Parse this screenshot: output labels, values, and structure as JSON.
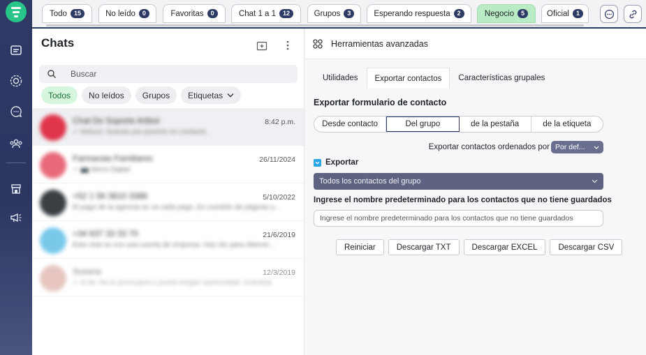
{
  "top_tabs": [
    {
      "label": "Todo",
      "count": "15",
      "active": false
    },
    {
      "label": "No leído",
      "count": "0",
      "active": false
    },
    {
      "label": "Favoritas",
      "count": "0",
      "active": false
    },
    {
      "label": "Chat 1 a 1",
      "count": "12",
      "active": false
    },
    {
      "label": "Grupos",
      "count": "3",
      "active": false
    },
    {
      "label": "Esperando respuesta",
      "count": "2",
      "active": false
    },
    {
      "label": "Negocio",
      "count": "5",
      "active": true
    },
    {
      "label": "Oficial",
      "count": "1",
      "active": false
    }
  ],
  "top_icons": [
    "chat-bubble-icon",
    "link-icon"
  ],
  "sidebar": {
    "icons": [
      "logo-icon",
      "inbox-icon",
      "status-icon",
      "chat-icon",
      "community-icon",
      "store-icon",
      "megaphone-icon"
    ]
  },
  "chats": {
    "title": "Chats",
    "search_placeholder": "Buscar",
    "filters": [
      {
        "label": "Todos",
        "active": true
      },
      {
        "label": "No leídos",
        "active": false
      },
      {
        "label": "Grupos",
        "active": false
      },
      {
        "label": "Etiquetas",
        "active": false
      }
    ],
    "list": [
      {
        "name": "Chat De Soporte Artbot",
        "preview": "✓ Nelson: Gracias por ponerte en contacto.",
        "time": "8:42 p.m.",
        "avatar_color": "#e0354b",
        "selected": true
      },
      {
        "name": "Farmacias Familiares",
        "preview": "✓ 📷 Menú Digital",
        "time": "26/11/2024",
        "avatar_color": "#e8697a",
        "selected": false
      },
      {
        "name": "+52 1 56 3810 3386",
        "preview": "El pago de la agencia se va cada pago. Es cuestión de páginas y...",
        "time": "5/10/2022",
        "avatar_color": "#3a3f44",
        "selected": false
      },
      {
        "name": "+34 637 33 33 70",
        "preview": "Este chat es con una cuenta de empresa. Haz clic para obtener...",
        "time": "21/6/2019",
        "avatar_color": "#79c8ea",
        "selected": false
      },
      {
        "name": "Susana",
        "preview": "✓ el de: No te preocupes y puedo tengan oportunidad. Graciasa",
        "time": "12/3/2019",
        "avatar_color": "#d9a7a0",
        "selected": false
      }
    ]
  },
  "tools": {
    "title": "Herramientas avanzadas",
    "subtabs": [
      {
        "label": "Utilidades",
        "active": false
      },
      {
        "label": "Exportar contactos",
        "active": true
      },
      {
        "label": "Características grupales",
        "active": false
      }
    ],
    "section_title": "Exportar formulario de contacto",
    "segments": [
      {
        "label": "Desde contacto",
        "active": false
      },
      {
        "label": "Del grupo",
        "active": true
      },
      {
        "label": "de la pestaña",
        "active": false
      },
      {
        "label": "de la etiqueta",
        "active": false
      }
    ],
    "order_label": "Exportar contactos ordenados por",
    "order_value": "Por def...",
    "export_label": "Exportar",
    "export_checked": true,
    "group_select": "Todos los contactos del grupo",
    "name_label": "Ingrese el nombre predeterminado para los contactos que no tiene guardados",
    "name_placeholder": "Ingrese el nombre predeterminado para los contactos que no tiene guardados",
    "buttons": {
      "reset": "Reiniciar",
      "txt": "Descargar TXT",
      "excel": "Descargar EXCEL",
      "csv": "Descargar CSV"
    }
  },
  "colors": {
    "brand": "#2e3a66",
    "accent_green": "#28c48a",
    "active_tab": "#b9ecc4",
    "select_bg": "#5f6382"
  }
}
